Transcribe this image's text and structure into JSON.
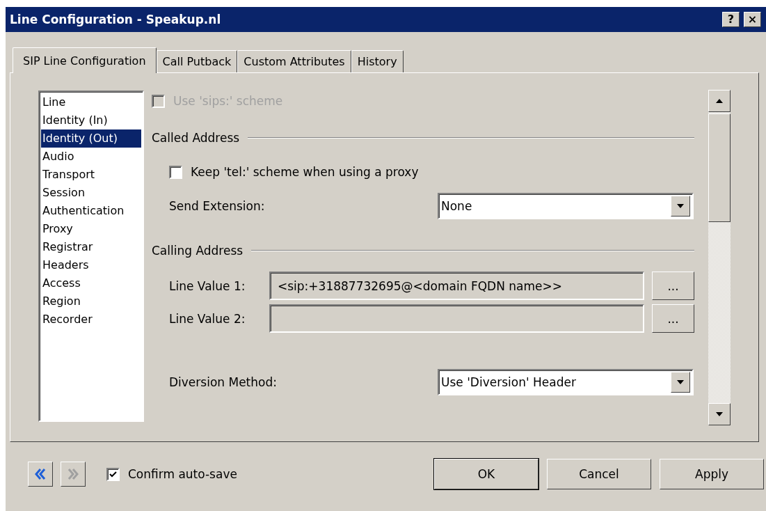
{
  "window": {
    "title": "Line Configuration - Speakup.nl",
    "help": "?",
    "close": "×"
  },
  "tabs": [
    {
      "label": "SIP Line Configuration",
      "selected": true
    },
    {
      "label": "Call Putback",
      "selected": false
    },
    {
      "label": "Custom Attributes",
      "selected": false
    },
    {
      "label": "History",
      "selected": false
    }
  ],
  "sidebar": {
    "items": [
      {
        "label": "Line",
        "selected": false
      },
      {
        "label": "Identity (In)",
        "selected": false
      },
      {
        "label": "Identity (Out)",
        "selected": true
      },
      {
        "label": "Audio",
        "selected": false
      },
      {
        "label": "Transport",
        "selected": false
      },
      {
        "label": "Session",
        "selected": false
      },
      {
        "label": "Authentication",
        "selected": false
      },
      {
        "label": "Proxy",
        "selected": false
      },
      {
        "label": "Registrar",
        "selected": false
      },
      {
        "label": "Headers",
        "selected": false
      },
      {
        "label": "Access",
        "selected": false
      },
      {
        "label": "Region",
        "selected": false
      },
      {
        "label": "Recorder",
        "selected": false
      }
    ]
  },
  "form": {
    "rows": [
      {
        "kind": "checkbox",
        "label": "Use 'sips:' scheme",
        "checked": false,
        "disabled": true
      },
      {
        "kind": "heading",
        "label": "Called Address"
      },
      {
        "kind": "checkbox",
        "label": "Keep 'tel:' scheme when using a proxy",
        "checked": false,
        "disabled": false
      },
      {
        "kind": "select",
        "label": "Send Extension:",
        "value": "None"
      },
      {
        "kind": "heading",
        "label": "Calling Address"
      },
      {
        "kind": "field",
        "label": "Line Value 1:",
        "value": "<sip:+31887732695@<domain FQDN name>>",
        "button": "..."
      },
      {
        "kind": "field",
        "label": "Line Value 2:",
        "button": "..."
      },
      {
        "kind": "select",
        "label": "Diversion Method:",
        "value": "Use 'Diversion' Header"
      }
    ]
  },
  "footer": {
    "back": {
      "disabled": false
    },
    "forward": {
      "disabled": true
    },
    "confirm": {
      "label": "Confirm auto-save",
      "checked": true
    },
    "buttons": [
      {
        "label": "OK",
        "default": true
      },
      {
        "label": "Cancel",
        "default": false
      },
      {
        "label": "Apply",
        "default": false
      }
    ]
  }
}
